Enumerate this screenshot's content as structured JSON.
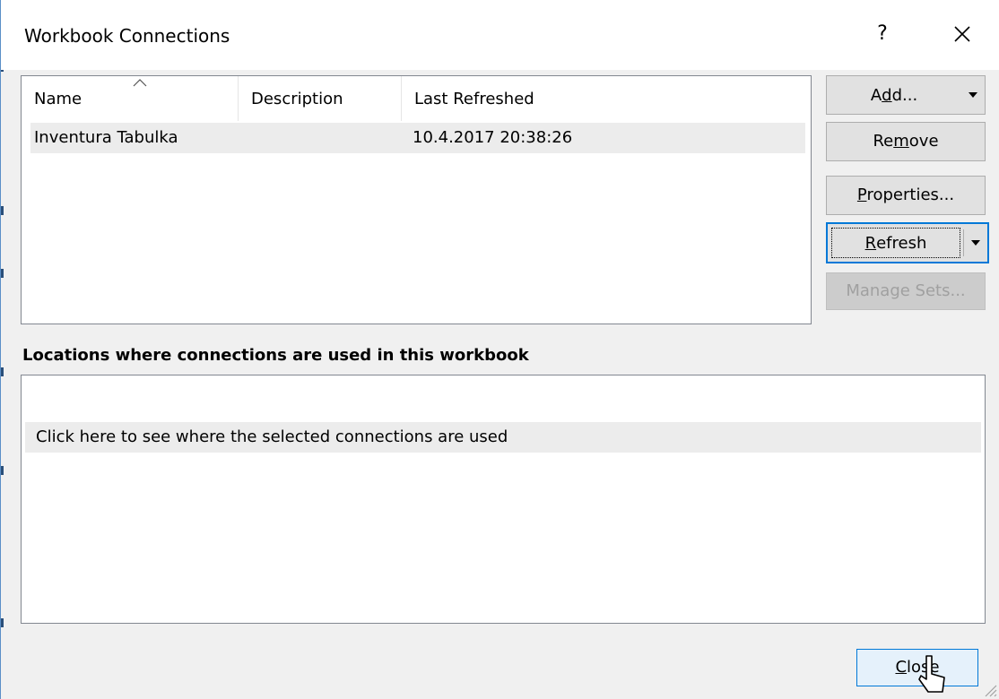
{
  "window": {
    "title": "Workbook Connections",
    "help_label": "?",
    "close_icon": "close-icon"
  },
  "connections": {
    "columns": [
      "Name",
      "Description",
      "Last Refreshed"
    ],
    "rows": [
      {
        "name": "Inventura Tabulka",
        "description": "",
        "last_refreshed": "10.4.2017  20:38:26"
      }
    ]
  },
  "buttons": {
    "add": {
      "pre": "A",
      "acc": "d",
      "post": "d..."
    },
    "remove": {
      "pre": "Re",
      "acc": "m",
      "post": "ove"
    },
    "properties": {
      "pre": "",
      "acc": "P",
      "post": "roperties..."
    },
    "refresh": {
      "pre": "",
      "acc": "R",
      "post": "efresh"
    },
    "manage_sets": "Manage Sets...",
    "close": {
      "pre": "",
      "acc": "C",
      "post": "lose"
    }
  },
  "locations": {
    "label": "Locations where connections are used in this workbook",
    "hint": "Click here to see where the selected connections are used"
  },
  "colors": {
    "focus_border": "#0078d7",
    "selected_row": "#ececec"
  }
}
